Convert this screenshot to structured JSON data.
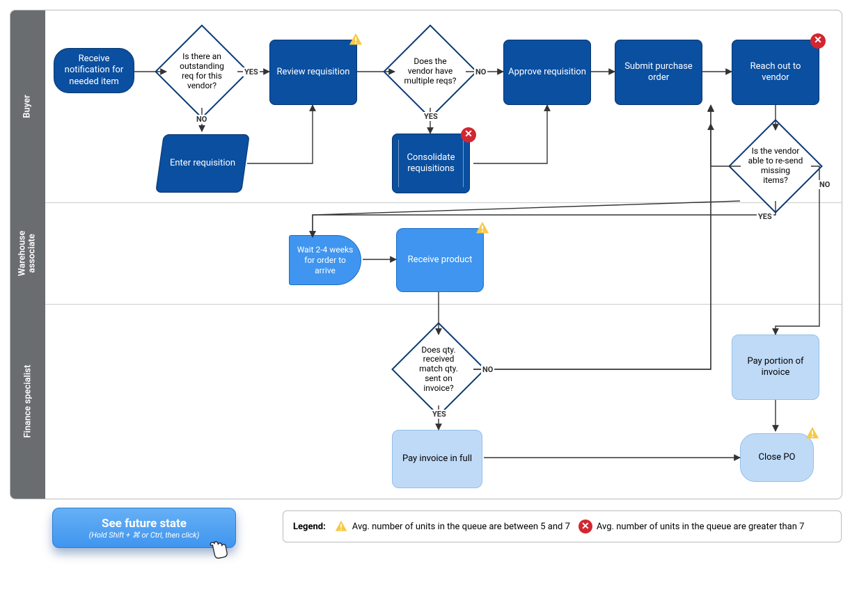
{
  "lanes": {
    "buyer": "Buyer",
    "warehouse": "Warehouse\nassociate",
    "finance": "Finance specialist"
  },
  "nodes": {
    "receive_notif": "Receive notification for needed item",
    "outstanding_req": "Is there an outstanding req for this vendor?",
    "review_req": "Review requisition",
    "enter_req": "Enter requisition",
    "vendor_multiple": "Does the vendor have multiple reqs?",
    "consolidate": "Consolidate requisitions",
    "approve_req": "Approve requisition",
    "submit_po": "Submit purchase order",
    "reach_vendor": "Reach out to vendor",
    "vendor_resend": "Is the vendor able to re-send missing items?",
    "wait": "Wait 2-4 weeks for order to arrive",
    "receive_product": "Receive product",
    "qty_match": "Does qty. received match qty. sent on invoice?",
    "pay_full": "Pay invoice in full",
    "pay_portion": "Pay portion of invoice",
    "close_po": "Close PO"
  },
  "edges": {
    "yes": "YES",
    "no": "NO"
  },
  "button": {
    "title": "See future state",
    "hint": "(Hold Shift + ⌘ or Ctrl, then click)"
  },
  "legend": {
    "label": "Legend:",
    "warn": "Avg. number of units in the queue are between 5 and  7",
    "err": "Avg. number of units in the queue are greater than 7"
  },
  "colors": {
    "lane": "#6a6d70",
    "dark": "#0a4fa0",
    "mid": "#3f95ef",
    "light": "#bfdaf7",
    "warn": "#f7c948",
    "err": "#d22630"
  }
}
